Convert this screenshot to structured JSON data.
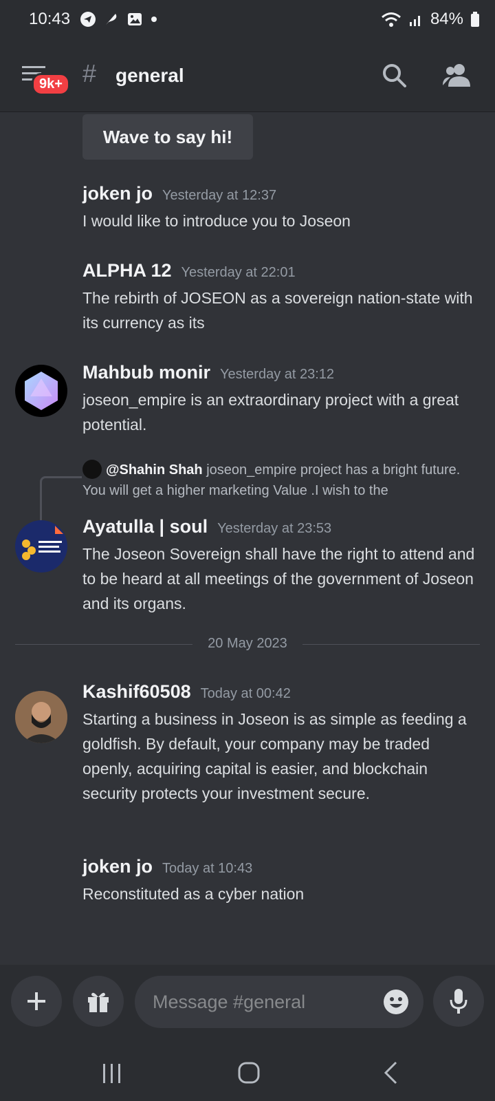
{
  "status": {
    "time": "10:43",
    "battery": "84%"
  },
  "header": {
    "badge": "9k+",
    "hash": "#",
    "channel": "general"
  },
  "chat": {
    "wave_label": "Wave to say hi!",
    "messages": [
      {
        "author": "joken  jo",
        "time": "Yesterday at 12:37",
        "text": "I would like to introduce you to Joseon"
      },
      {
        "author": "ALPHA 12",
        "time": "Yesterday at 22:01",
        "text": "The rebirth of JOSEON as a sovereign nation-state with its currency as its"
      },
      {
        "author": "Mahbub monir",
        "time": "Yesterday at 23:12",
        "text": "joseon_empire is an extraordinary project with a great potential."
      },
      {
        "author": "Ayatulla | soul",
        "time": "Yesterday at 23:53",
        "text": "The Joseon Sovereign shall have the right to attend and to be heard at all meetings of the government of Joseon and its organs."
      },
      {
        "author": "Kashif60508",
        "time": "Today at 00:42",
        "text": "Starting a business in Joseon is as simple as feeding a goldfish. By default, your company may be traded openly, acquiring capital is easier, and blockchain security protects your investment secure."
      },
      {
        "author": "joken  jo",
        "time": "Today at 10:43",
        "text": "Reconstituted as a cyber nation"
      }
    ],
    "reply": {
      "author": "@Shahin Shah",
      "text": "joseon_empire project has a bright future. You will get a higher marketing Value .I wish to the"
    },
    "date_divider": "20 May 2023"
  },
  "composer": {
    "placeholder": "Message #general"
  },
  "colors": {
    "background": "#313338",
    "header": "#2b2d31",
    "badge": "#f23f43"
  }
}
